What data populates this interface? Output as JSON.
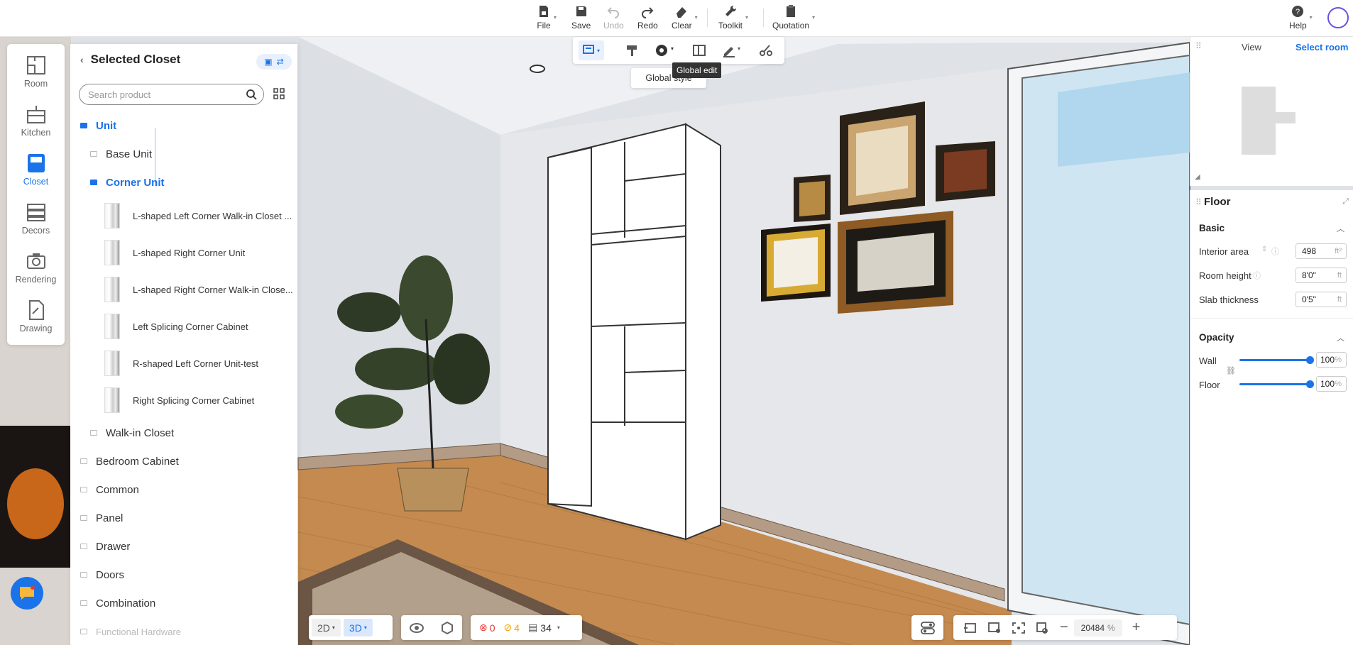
{
  "toolbar": {
    "file": "File",
    "save": "Save",
    "undo": "Undo",
    "redo": "Redo",
    "clear": "Clear",
    "toolkit": "Toolkit",
    "quotation": "Quotation",
    "help": "Help"
  },
  "sidebar": {
    "items": [
      {
        "label": "Room",
        "icon": "room-icon"
      },
      {
        "label": "Kitchen",
        "icon": "kitchen-icon"
      },
      {
        "label": "Closet",
        "icon": "closet-icon",
        "active": true
      },
      {
        "label": "Decors",
        "icon": "decors-icon"
      },
      {
        "label": "Rendering",
        "icon": "camera-icon"
      },
      {
        "label": "Drawing",
        "icon": "drawing-icon"
      }
    ]
  },
  "panel": {
    "title": "Selected Closet",
    "search_placeholder": "Search product",
    "tree": {
      "unit": "Unit",
      "base_unit": "Base Unit",
      "corner_unit": "Corner Unit",
      "products": [
        "L-shaped Left Corner Walk-in Closet ...",
        "L-shaped Right Corner Unit",
        "L-shaped Right Corner Walk-in Close...",
        "Left Splicing Corner Cabinet",
        "R-shaped Left Corner Unit-test",
        "Right Splicing Corner Cabinet"
      ],
      "walk_in": "Walk-in Closet",
      "categories": [
        "Bedroom Cabinet",
        "Common",
        "Panel",
        "Drawer",
        "Doors",
        "Combination",
        "Functional Hardware"
      ]
    }
  },
  "subtoolbar": {
    "tooltip": "Global edit",
    "dropdown_item": "Global style"
  },
  "view_panel": {
    "view_label": "View",
    "select_room": "Select room"
  },
  "floor_panel": {
    "title": "Floor",
    "basic": "Basic",
    "interior_area_label": "Interior area",
    "interior_area": "498",
    "interior_area_unit": "ft²",
    "room_height_label": "Room height",
    "room_height": "8'0\"",
    "room_height_unit": "ft",
    "slab_label": "Slab thickness",
    "slab": "0'5\"",
    "slab_unit": "ft",
    "opacity": "Opacity",
    "wall_label": "Wall",
    "wall_value": "100",
    "floor_label": "Floor",
    "floor_value": "100",
    "percent": "%"
  },
  "bottom": {
    "mode_2d": "2D",
    "mode_3d": "3D",
    "errors": "0",
    "warnings": "4",
    "items": "34",
    "zoom": "20484",
    "zoom_unit": "%"
  },
  "colors": {
    "accent": "#1a73e8",
    "error": "#e53935",
    "warning": "#f4a300"
  }
}
